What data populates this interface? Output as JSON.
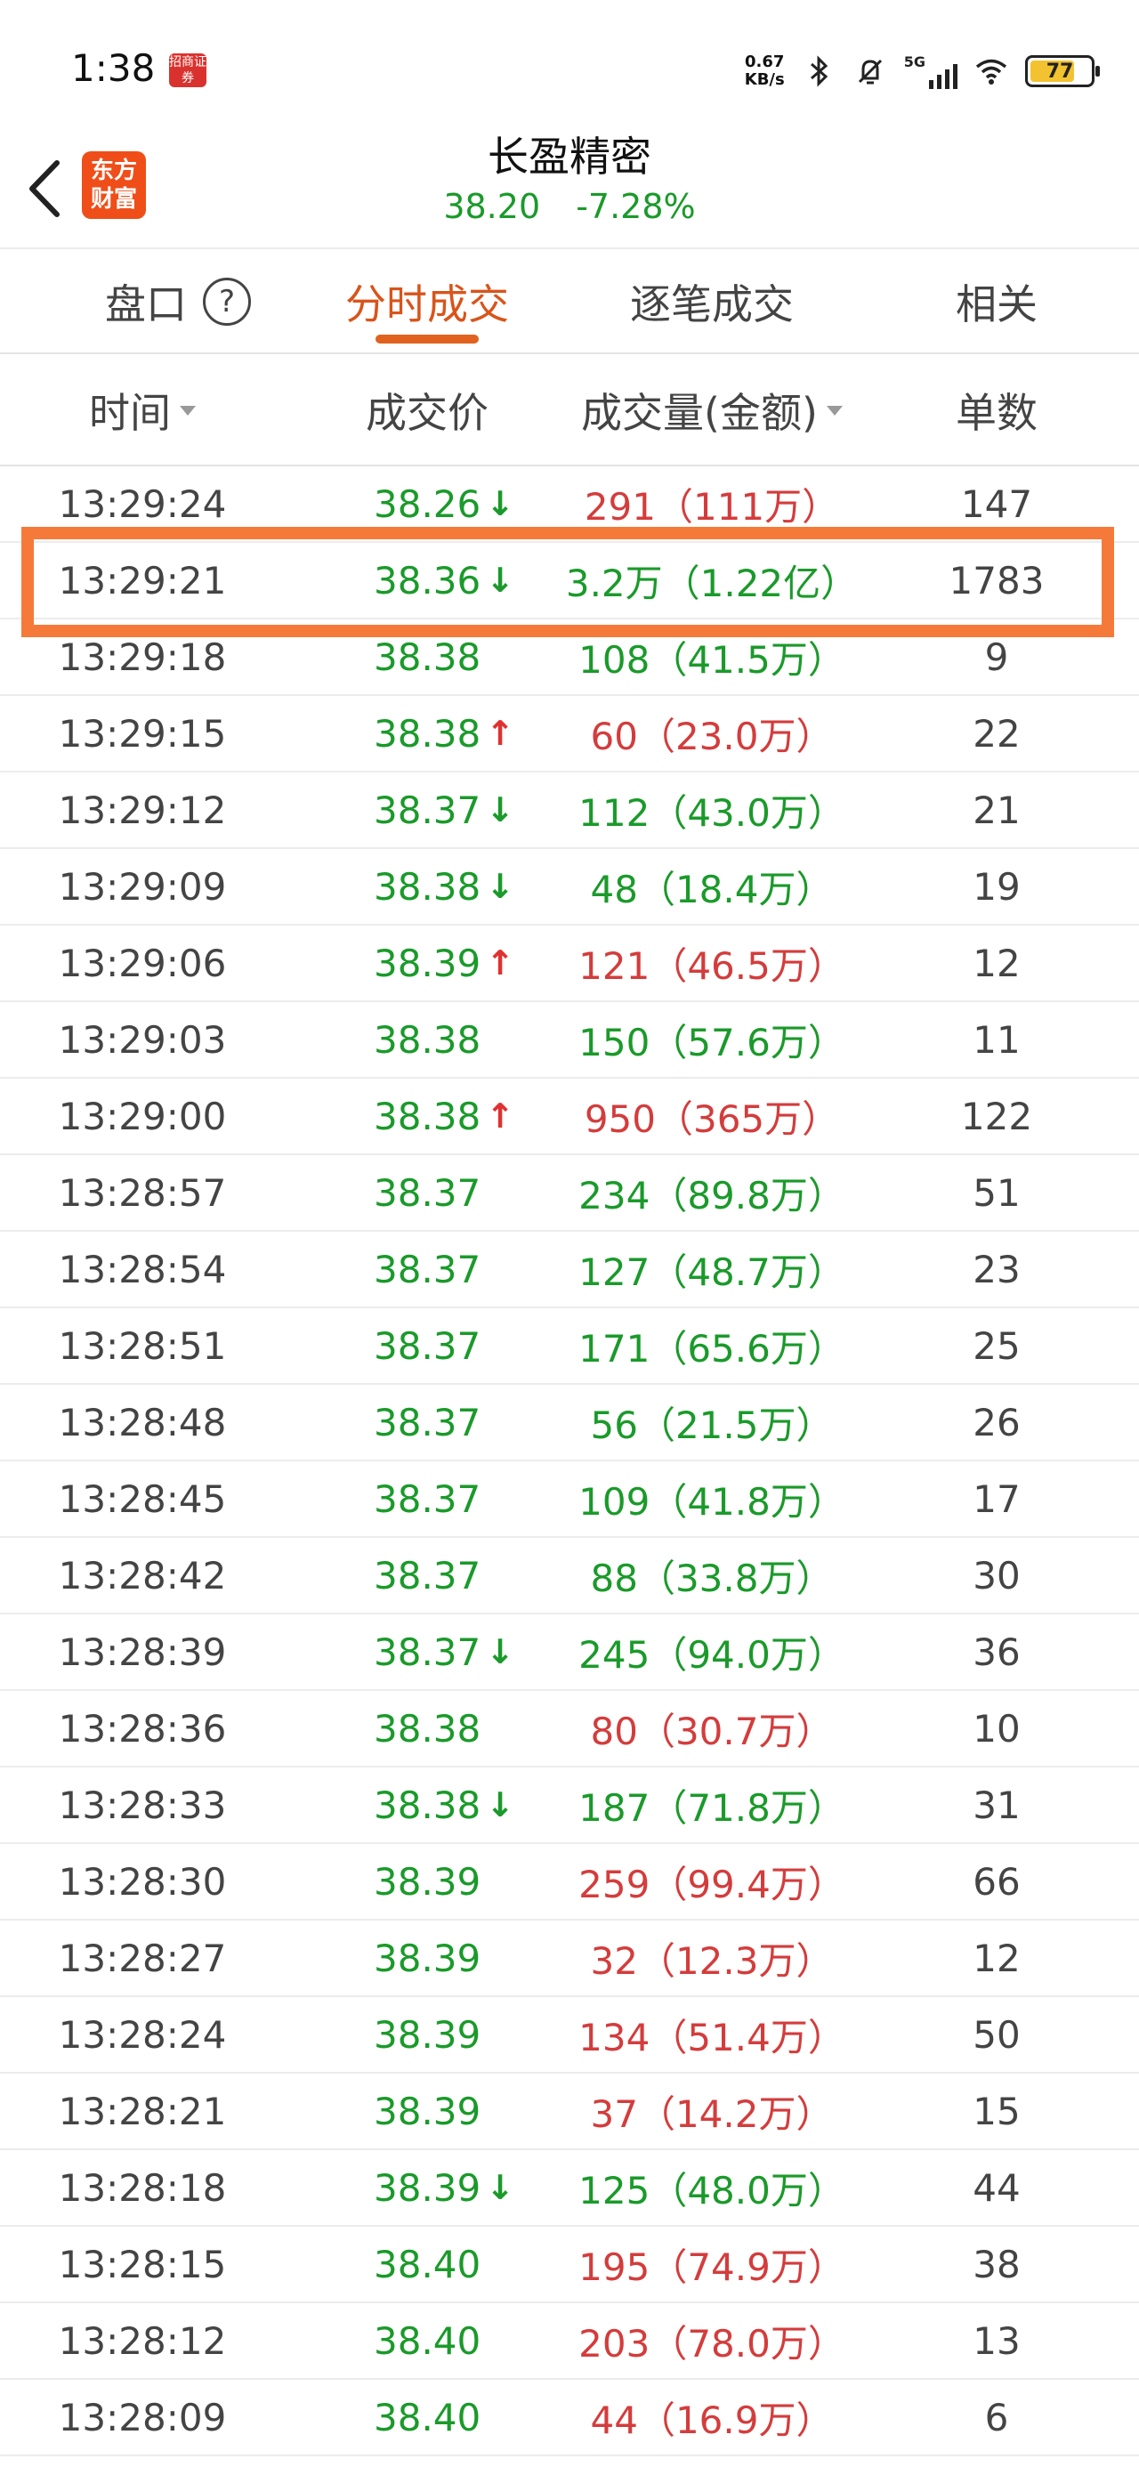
{
  "status_bar": {
    "time": "1:38",
    "app_icon_text": "招商证券",
    "net_speed_value": "0.67",
    "net_speed_unit": "KB/s",
    "signal_label": "5G",
    "battery_level": "77"
  },
  "header": {
    "logo_line1": "东方",
    "logo_line2": "财富",
    "stock_name": "长盈精密",
    "price": "38.20",
    "change_pct": "-7.28%"
  },
  "tabs": [
    {
      "label": "盘口"
    },
    {
      "label": "分时成交"
    },
    {
      "label": "逐笔成交"
    },
    {
      "label": "相关"
    }
  ],
  "columns": {
    "time": "时间",
    "price": "成交价",
    "volume": "成交量(金额)",
    "count": "单数"
  },
  "colors": {
    "accent": "#e0621e",
    "up_red": "#d43c3c",
    "down_green": "#1a9a2a",
    "highlight": "#f57a3a"
  },
  "rows": [
    {
      "time": "13:29:24",
      "price": "38.26",
      "dir": "down",
      "volume": "291（111万）",
      "vol_color": "red",
      "count": "147"
    },
    {
      "time": "13:29:21",
      "price": "38.36",
      "dir": "down",
      "volume": "3.2万（1.22亿）",
      "vol_color": "green",
      "count": "1783"
    },
    {
      "time": "13:29:18",
      "price": "38.38",
      "dir": "",
      "volume": "108（41.5万）",
      "vol_color": "green",
      "count": "9"
    },
    {
      "time": "13:29:15",
      "price": "38.38",
      "dir": "up",
      "volume": "60（23.0万）",
      "vol_color": "red",
      "count": "22"
    },
    {
      "time": "13:29:12",
      "price": "38.37",
      "dir": "down",
      "volume": "112（43.0万）",
      "vol_color": "green",
      "count": "21"
    },
    {
      "time": "13:29:09",
      "price": "38.38",
      "dir": "down",
      "volume": "48（18.4万）",
      "vol_color": "green",
      "count": "19"
    },
    {
      "time": "13:29:06",
      "price": "38.39",
      "dir": "up",
      "volume": "121（46.5万）",
      "vol_color": "red",
      "count": "12"
    },
    {
      "time": "13:29:03",
      "price": "38.38",
      "dir": "",
      "volume": "150（57.6万）",
      "vol_color": "green",
      "count": "11"
    },
    {
      "time": "13:29:00",
      "price": "38.38",
      "dir": "up",
      "volume": "950（365万）",
      "vol_color": "red",
      "count": "122"
    },
    {
      "time": "13:28:57",
      "price": "38.37",
      "dir": "",
      "volume": "234（89.8万）",
      "vol_color": "green",
      "count": "51"
    },
    {
      "time": "13:28:54",
      "price": "38.37",
      "dir": "",
      "volume": "127（48.7万）",
      "vol_color": "green",
      "count": "23"
    },
    {
      "time": "13:28:51",
      "price": "38.37",
      "dir": "",
      "volume": "171（65.6万）",
      "vol_color": "green",
      "count": "25"
    },
    {
      "time": "13:28:48",
      "price": "38.37",
      "dir": "",
      "volume": "56（21.5万）",
      "vol_color": "green",
      "count": "26"
    },
    {
      "time": "13:28:45",
      "price": "38.37",
      "dir": "",
      "volume": "109（41.8万）",
      "vol_color": "green",
      "count": "17"
    },
    {
      "time": "13:28:42",
      "price": "38.37",
      "dir": "",
      "volume": "88（33.8万）",
      "vol_color": "green",
      "count": "30"
    },
    {
      "time": "13:28:39",
      "price": "38.37",
      "dir": "down",
      "volume": "245（94.0万）",
      "vol_color": "green",
      "count": "36"
    },
    {
      "time": "13:28:36",
      "price": "38.38",
      "dir": "",
      "volume": "80（30.7万）",
      "vol_color": "red",
      "count": "10"
    },
    {
      "time": "13:28:33",
      "price": "38.38",
      "dir": "down",
      "volume": "187（71.8万）",
      "vol_color": "green",
      "count": "31"
    },
    {
      "time": "13:28:30",
      "price": "38.39",
      "dir": "",
      "volume": "259（99.4万）",
      "vol_color": "red",
      "count": "66"
    },
    {
      "time": "13:28:27",
      "price": "38.39",
      "dir": "",
      "volume": "32（12.3万）",
      "vol_color": "red",
      "count": "12"
    },
    {
      "time": "13:28:24",
      "price": "38.39",
      "dir": "",
      "volume": "134（51.4万）",
      "vol_color": "red",
      "count": "50"
    },
    {
      "time": "13:28:21",
      "price": "38.39",
      "dir": "",
      "volume": "37（14.2万）",
      "vol_color": "red",
      "count": "15"
    },
    {
      "time": "13:28:18",
      "price": "38.39",
      "dir": "down",
      "volume": "125（48.0万）",
      "vol_color": "green",
      "count": "44"
    },
    {
      "time": "13:28:15",
      "price": "38.40",
      "dir": "",
      "volume": "195（74.9万）",
      "vol_color": "red",
      "count": "38"
    },
    {
      "time": "13:28:12",
      "price": "38.40",
      "dir": "",
      "volume": "203（78.0万）",
      "vol_color": "red",
      "count": "13"
    },
    {
      "time": "13:28:09",
      "price": "38.40",
      "dir": "",
      "volume": "44（16.9万）",
      "vol_color": "red",
      "count": "6"
    }
  ]
}
